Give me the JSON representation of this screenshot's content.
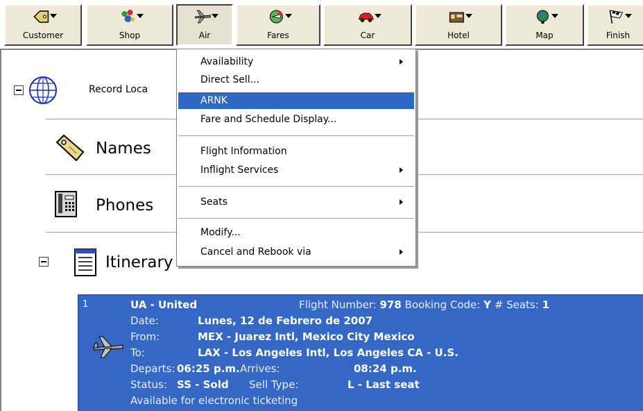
{
  "toolbar": {
    "buttons": [
      {
        "label": "Customer",
        "icon": "tag-icon"
      },
      {
        "label": "Shop",
        "icon": "shop-icon"
      },
      {
        "label": "Air",
        "icon": "airplane-icon"
      },
      {
        "label": "Fares",
        "icon": "fares-icon"
      },
      {
        "label": "Car",
        "icon": "car-icon"
      },
      {
        "label": "Hotel",
        "icon": "hotel-icon"
      },
      {
        "label": "Map",
        "icon": "globe-icon"
      },
      {
        "label": "Finish",
        "icon": "checkered-flag-icon"
      }
    ]
  },
  "tree": {
    "record_locator": "Record Loca",
    "names": "Names",
    "phones": "Phones",
    "itinerary": "Itinerary"
  },
  "menu": {
    "items": [
      {
        "label": "Availability",
        "submenu": true
      },
      {
        "label": "Direct Sell...",
        "submenu": false
      },
      {
        "label": "ARNK",
        "submenu": false,
        "highlighted": true
      },
      {
        "label": "Fare and Schedule Display...",
        "submenu": false
      },
      {
        "label": "Flight Information",
        "submenu": false
      },
      {
        "label": "Inflight Services",
        "submenu": true
      },
      {
        "label": "Seats",
        "submenu": true
      },
      {
        "label": "Modify...",
        "submenu": false
      },
      {
        "label": "Cancel and Rebook via",
        "submenu": true
      }
    ]
  },
  "segment": {
    "index": "1",
    "carrier": "UA - United",
    "flight_number_label": "Flight Number:",
    "flight_number": "978",
    "booking_code_label": "Booking Code:",
    "booking_code": "Y",
    "seats_label": "# Seats:",
    "seats": "1",
    "date_label": "Date:",
    "date": "Lunes, 12 de Febrero de 2007",
    "from_label": "From:",
    "from": "MEX - Juarez Intl, Mexico City Mexico",
    "to_label": "To:",
    "to": "LAX - Los Angeles Intl, Los Angeles CA - U.S.",
    "departs_label": "Departs:",
    "departs": "06:25 p.m.",
    "arrives_label": "Arrives:",
    "arrives": "08:24 p.m.",
    "status_label": "Status:",
    "status": "SS - Sold",
    "sell_type_label": "Sell Type:",
    "sell_type": "L - Last seat",
    "eticket_note": "Available for electronic ticketing"
  },
  "colors": {
    "menu_highlight": "#3168c6",
    "itinerary_bg": "#3568c4"
  }
}
